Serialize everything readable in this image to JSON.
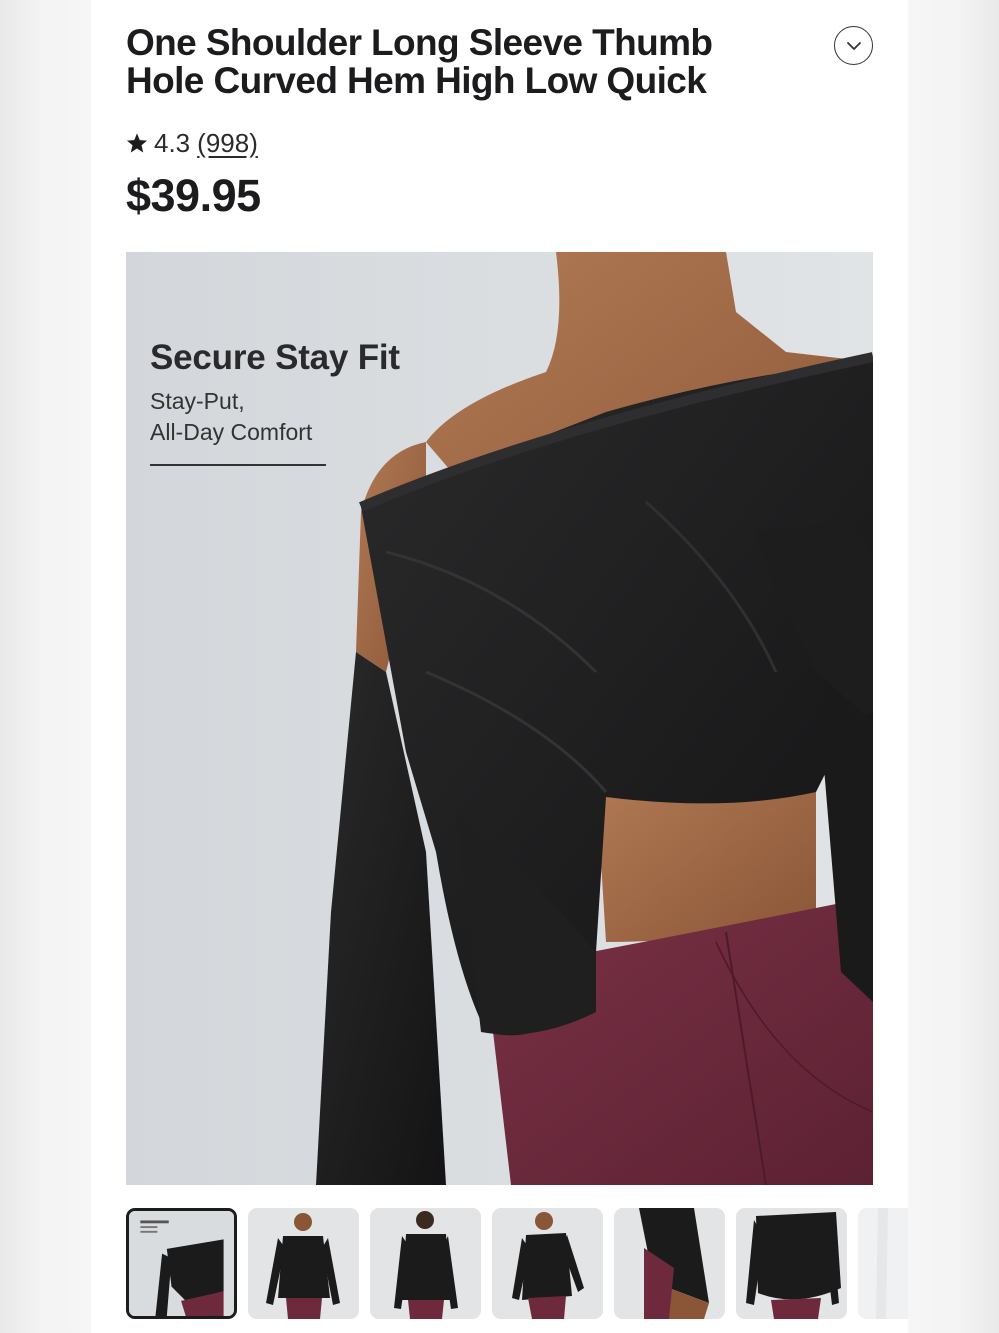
{
  "product": {
    "title": "One Shoulder Long Sleeve Thumb Hole Curved Hem High Low Quick",
    "rating": "4.3",
    "review_count": "(998)",
    "price": "$39.95"
  },
  "hero": {
    "promo_title": "Secure Stay Fit",
    "promo_subtitle_line1": "Stay-Put,",
    "promo_subtitle_line2": "All-Day Comfort"
  },
  "thumbnails": [
    {
      "selected": true
    },
    {
      "selected": false
    },
    {
      "selected": false
    },
    {
      "selected": false
    },
    {
      "selected": false
    },
    {
      "selected": false
    },
    {
      "selected": false
    }
  ],
  "colors": {
    "text": "#1c1c1f",
    "top": "#1b1b1c",
    "leggings": "#6e2a3c",
    "backdrop": "#d8dcdf"
  }
}
